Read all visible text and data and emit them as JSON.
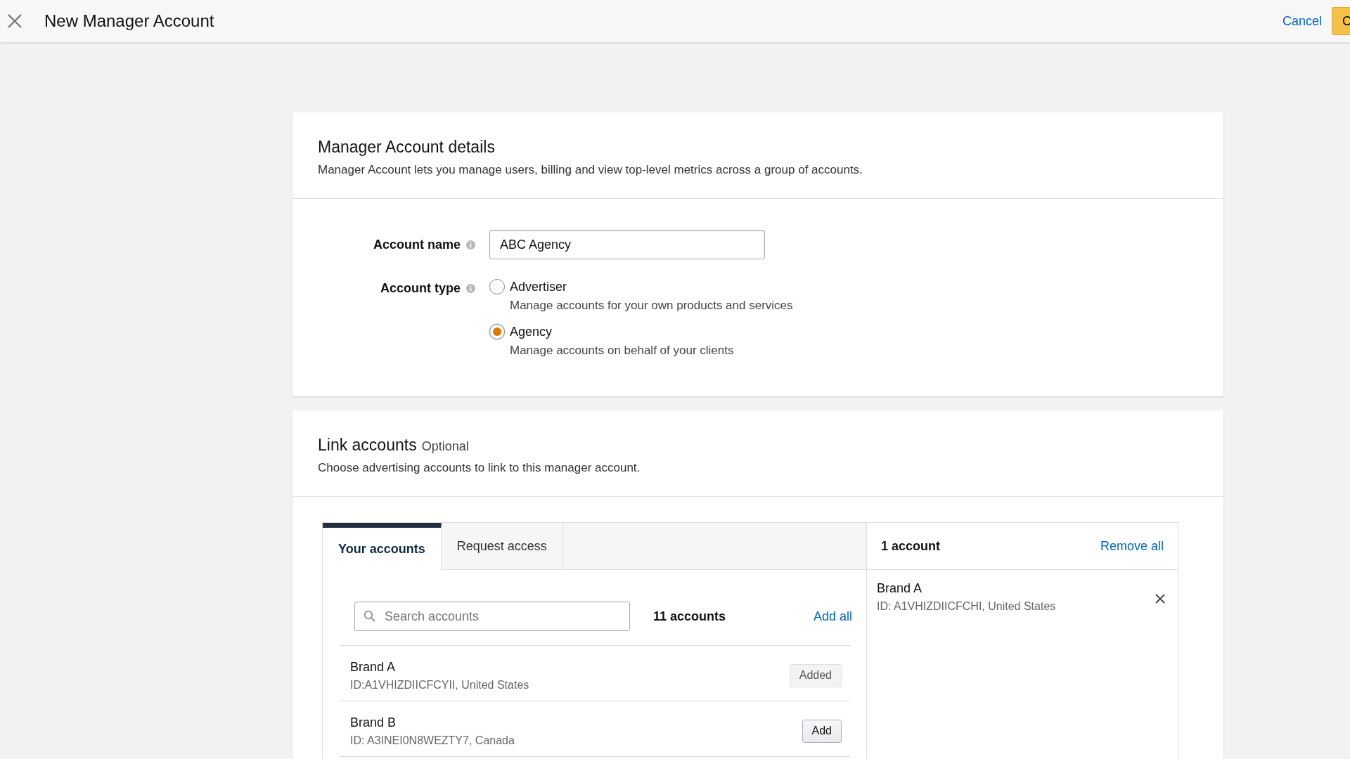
{
  "header": {
    "title": "New Manager Account",
    "cancel": "Cancel",
    "primary": "C"
  },
  "details": {
    "title": "Manager Account details",
    "description": "Manager Account lets you manage users, billing and view top-level metrics across a group of accounts.",
    "account_name": {
      "label": "Account name",
      "value": "ABC Agency"
    },
    "account_type": {
      "label": "Account type",
      "options": [
        {
          "label": "Advertiser",
          "description": "Manage accounts for your own products and services",
          "selected": false
        },
        {
          "label": "Agency",
          "description": "Manage accounts on behalf of your clients",
          "selected": true
        }
      ]
    }
  },
  "link": {
    "title": "Link accounts",
    "optional": "Optional",
    "description": "Choose advertising accounts to link to this manager account.",
    "tabs": [
      {
        "label": "Your accounts",
        "selected": true
      },
      {
        "label": "Request access",
        "selected": false
      }
    ],
    "search": {
      "placeholder": "Search accounts"
    },
    "count": "11 accounts",
    "add_all": "Add all",
    "accounts": [
      {
        "name": "Brand A",
        "detail": "ID:A1VHIZDIICFCYII, United States",
        "button": "Added",
        "added": true
      },
      {
        "name": "Brand B",
        "detail": "ID: A3INEI0N8WEZTY7, Canada",
        "button": "Add",
        "added": false
      }
    ],
    "selected_count": "1 account",
    "remove_all": "Remove all",
    "selected": [
      {
        "name": "Brand A",
        "detail": "ID: A1VHIZDIICFCHI, United States"
      }
    ]
  }
}
